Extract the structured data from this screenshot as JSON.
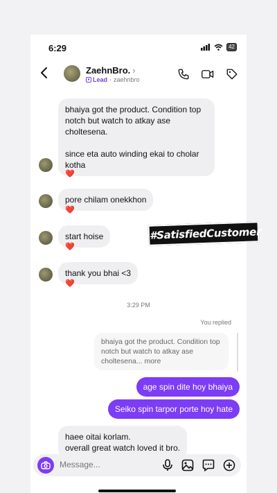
{
  "status": {
    "time": "6:29",
    "battery": "42"
  },
  "header": {
    "name": "ZaehnBro.",
    "chevron": "›",
    "lead_label": "Lead",
    "separator": "·",
    "username": "zaehnbro"
  },
  "messages_in": [
    {
      "text": "bhaiya got the product. Condition top notch but watch to atkay ase choltesena.\n\nsince eta auto winding ekai to cholar kotha",
      "reaction": "❤️"
    },
    {
      "text": "pore chilam onekkhon",
      "reaction": "❤️"
    },
    {
      "text": "start hoise",
      "reaction": "❤️"
    },
    {
      "text": "thank you bhai <3",
      "reaction": "❤️"
    }
  ],
  "timestamp": "3:29 PM",
  "you_replied": "You replied",
  "quoted": {
    "text": "bhaiya got the product. Condition top notch but watch to atkay ase choltesena...",
    "more": "more"
  },
  "messages_out": [
    {
      "text": "age spin dite hoy bhaiya"
    },
    {
      "text": "Seiko spin tarpor porte hoy hate"
    }
  ],
  "last_in": {
    "text": "haee oitai korlam.\noverall great watch loved it bro."
  },
  "overlay": {
    "hashtag": "#SatisfiedCustomer"
  },
  "composer": {
    "placeholder": "Message..."
  },
  "colors": {
    "accent": "#7d3cf5",
    "bubble_in": "#efeff1",
    "heart": "#e0245e"
  },
  "icons": [
    "back-icon",
    "phone-icon",
    "video-icon",
    "tag-icon",
    "camera-icon",
    "microphone-icon",
    "gallery-icon",
    "sticker-icon",
    "plus-icon"
  ]
}
